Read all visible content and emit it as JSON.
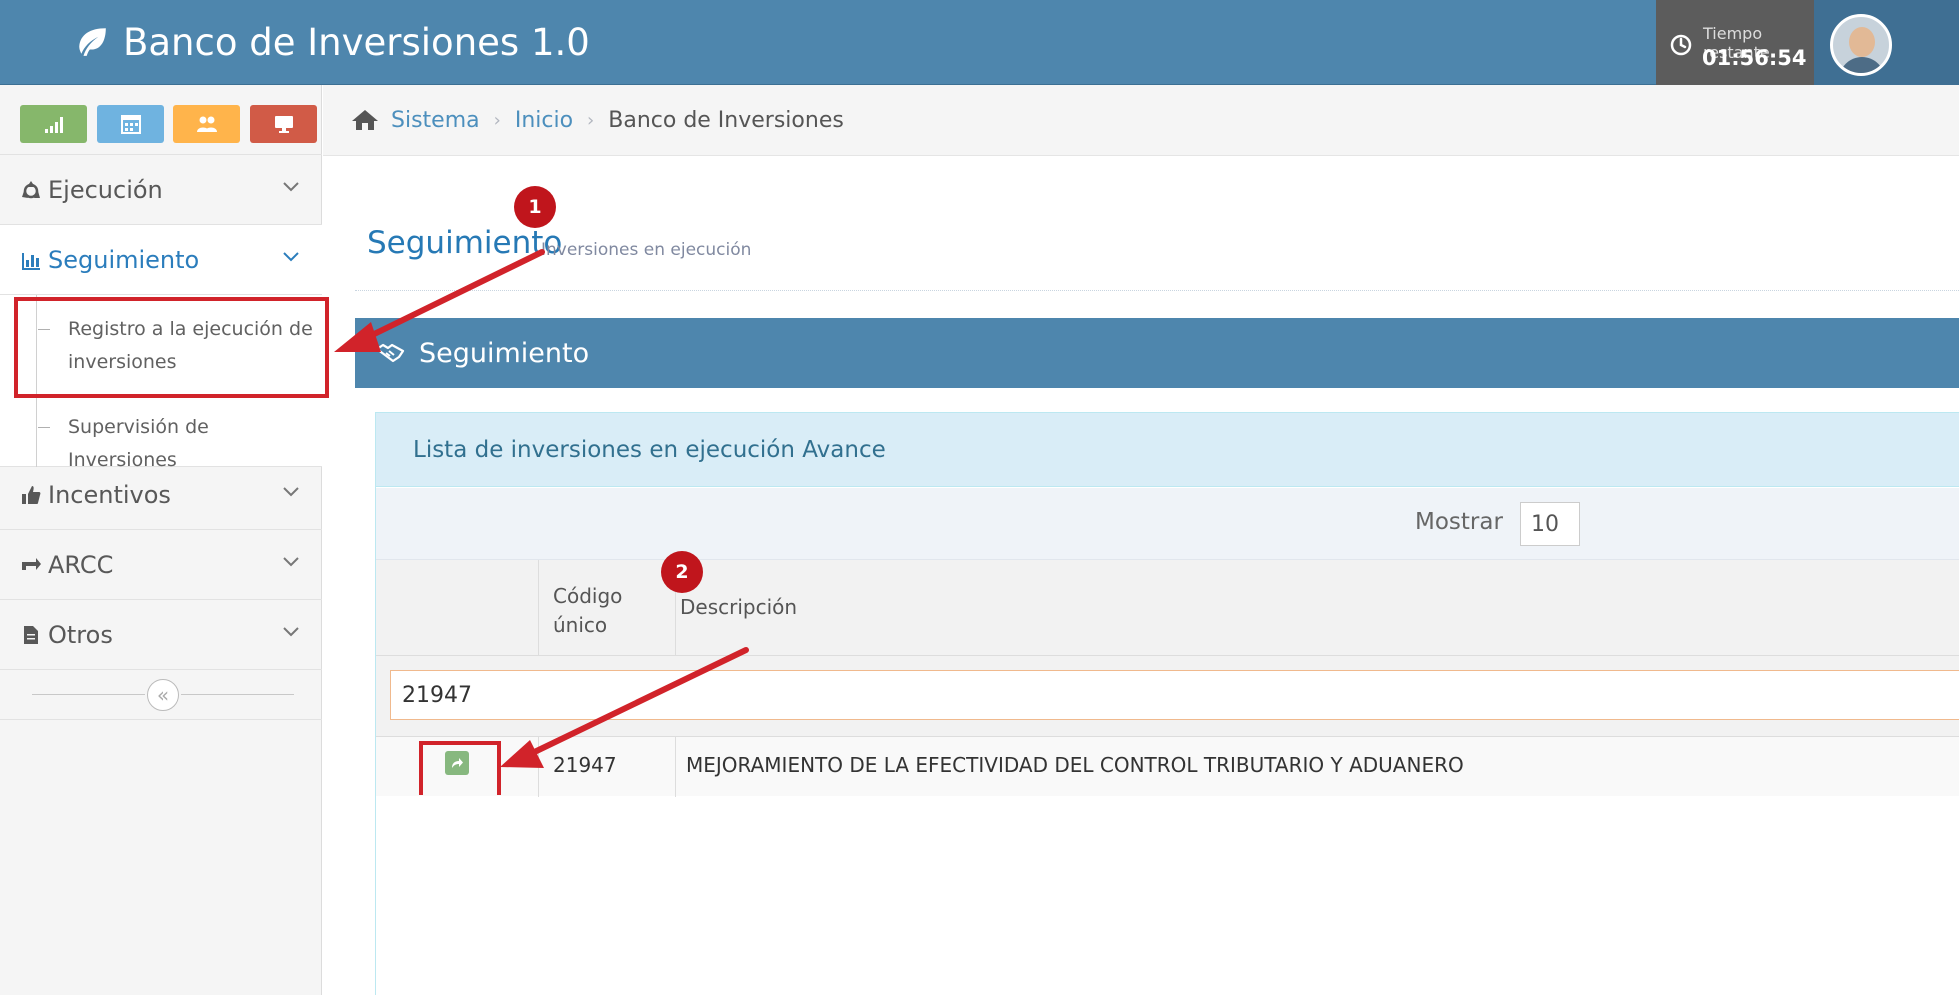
{
  "app": {
    "title": "Banco de Inversiones 1.0",
    "timer_label": "Tiempo restante",
    "timer_value": "01:56:54"
  },
  "shortcuts": [
    {
      "icon": "signal-icon",
      "color": "#86b76b"
    },
    {
      "icon": "calendar-icon",
      "color": "#6fb3e0"
    },
    {
      "icon": "users-icon",
      "color": "#ffb44b"
    },
    {
      "icon": "desktop-icon",
      "color": "#d15b47"
    }
  ],
  "sidebar": {
    "items": [
      {
        "label": "Ejecución",
        "icon": "recycle-icon"
      },
      {
        "label": "Seguimiento",
        "icon": "bar-chart-icon",
        "active": true
      },
      {
        "label": "Incentivos",
        "icon": "thumbs-up-icon"
      },
      {
        "label": "ARCC",
        "icon": "exchange-icon"
      },
      {
        "label": "Otros",
        "icon": "file-icon"
      }
    ],
    "submenu": [
      "Registro a la ejecución de",
      "inversiones",
      "Supervisión de Inversiones"
    ],
    "collapse_glyph": "«"
  },
  "breadcrumb": {
    "items": [
      "Sistema",
      "Inicio",
      "Banco de Inversiones"
    ],
    "separator": "›"
  },
  "page": {
    "title": "Seguimiento",
    "subtitle": "Inversiones en ejecución"
  },
  "widget": {
    "title": "Seguimiento"
  },
  "panel": {
    "title": "Lista de inversiones en ejecución Avance",
    "show_label": "Mostrar",
    "show_value": "10",
    "columns": [
      "Código",
      "único",
      "Descripción"
    ],
    "filter_value": "21947",
    "rows": [
      {
        "code": "21947",
        "description": "MEJORAMIENTO DE LA EFECTIVIDAD DEL CONTROL TRIBUTARIO Y ADUANERO"
      }
    ]
  },
  "annotations": {
    "markers": [
      "1",
      "2"
    ],
    "color": "#c0151c"
  }
}
